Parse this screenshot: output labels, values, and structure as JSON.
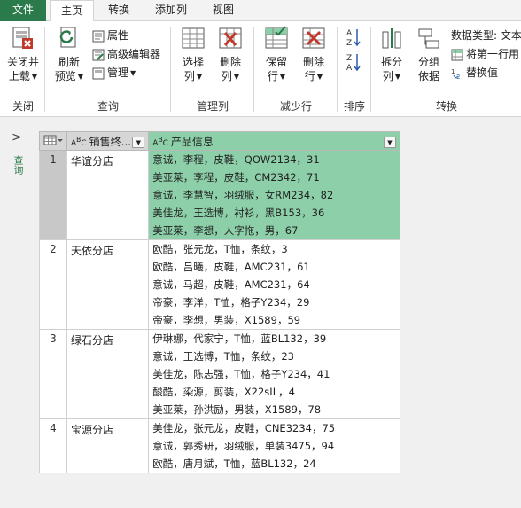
{
  "tabs": [
    {
      "label": "文件"
    },
    {
      "label": "主页"
    },
    {
      "label": "转换"
    },
    {
      "label": "添加列"
    },
    {
      "label": "视图"
    }
  ],
  "ribbon": {
    "close": {
      "label1": "关闭并",
      "label2": "上载",
      "group": "关闭"
    },
    "query": {
      "refresh1": "刷新",
      "refresh2": "预览",
      "properties": "属性",
      "advanced_editor": "高级编辑器",
      "manage": "管理",
      "group": "查询"
    },
    "manage_cols": {
      "select1": "选择",
      "select2": "列",
      "remove1": "删除",
      "remove2": "列",
      "group": "管理列"
    },
    "reduce_rows": {
      "keep1": "保留",
      "keep2": "行",
      "remove1": "删除",
      "remove2": "行",
      "group": "减少行"
    },
    "sort": {
      "group": "排序"
    },
    "transform": {
      "split1": "拆分",
      "split2": "列",
      "groupby1": "分组",
      "groupby2": "依据",
      "data_type": "数据类型: 文本",
      "first_row": "将第一行用",
      "replace": "替换值",
      "group": "转换"
    }
  },
  "left_pane": {
    "label": "查询"
  },
  "grid": {
    "columns": [
      {
        "label": "销售终..."
      },
      {
        "label": "产品信息"
      }
    ],
    "rows": [
      {
        "index": "1",
        "store": "华谊分店",
        "items": [
          "意诚，李程，皮鞋，QOW2134，31",
          "美亚莱，李程，皮鞋，CM2342，71",
          "意诚，李慧智，羽绒服，女RM234，82",
          "美佳龙，王选博，衬衫，黑B153，36",
          "美亚莱，李想，人字拖，男，67"
        ]
      },
      {
        "index": "2",
        "store": "天依分店",
        "items": [
          "欧酷，张元龙，T恤，条纹，3",
          "欧酷，吕曦，皮鞋，AMC231，61",
          "意诚，马超，皮鞋，AMC231，64",
          "帝豪，李洋，T恤，格子Y234，29",
          "帝豪，李想，男装，X1589，59"
        ]
      },
      {
        "index": "3",
        "store": "绿石分店",
        "items": [
          "伊琳娜，代家宁，T恤，蓝BL132，39",
          "意诚，王选博，T恤，条纹，23",
          "美佳龙，陈志强，T恤，格子Y234，41",
          "酸酷，染源，剪装，X22sIL，4",
          "美亚莱，孙洪励，男装，X1589，78"
        ]
      },
      {
        "index": "4",
        "store": "宝源分店",
        "items": [
          "美佳龙，张元龙，皮鞋，CNE3234，75",
          "意诚，郭秀研，羽绒服，单装3475，94",
          "欧酷，唐月斌，T恤，蓝BL132，24"
        ]
      }
    ]
  },
  "colors": {
    "accent": "#2b7a4b",
    "selection": "#8ccfa9"
  }
}
